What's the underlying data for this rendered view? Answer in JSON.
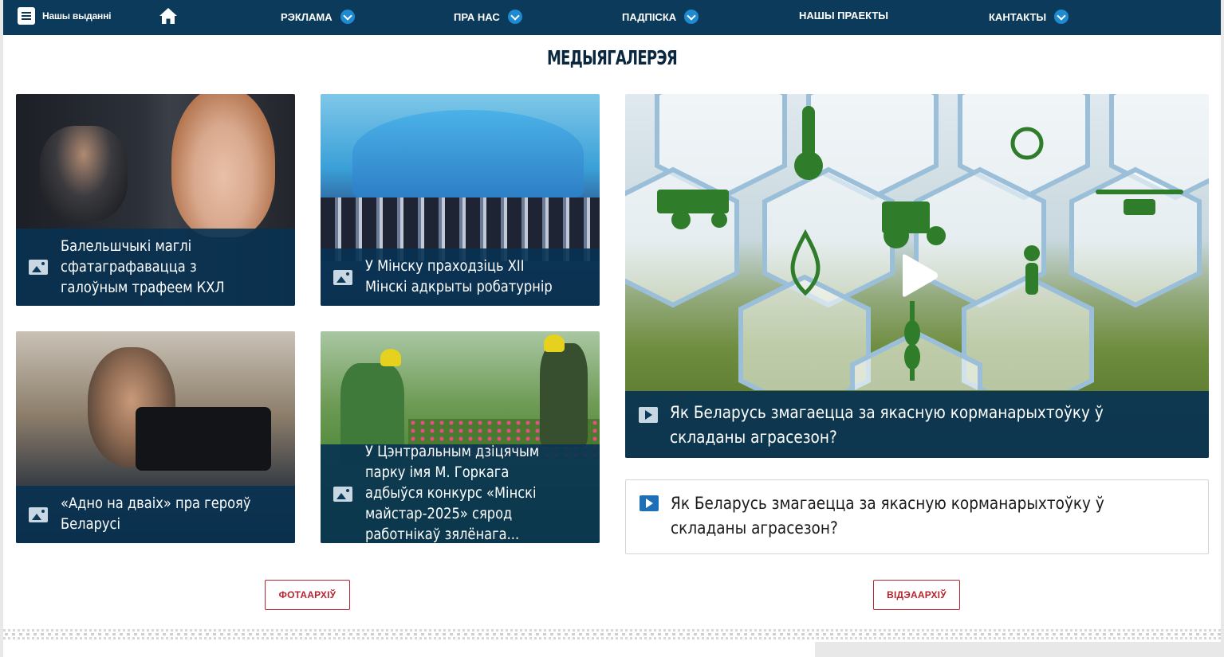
{
  "nav": {
    "menu_label": "Нашы выданні",
    "home_icon": "home-icon",
    "items": [
      {
        "label": "РЭКЛАМА",
        "has_dropdown": true
      },
      {
        "label": "ПРА НАС",
        "has_dropdown": true
      },
      {
        "label": "ПАДПІСКА",
        "has_dropdown": true
      },
      {
        "label": "НАШЫ ПРАЕКТЫ",
        "has_dropdown": false
      },
      {
        "label": "КАНТАКТЫ",
        "has_dropdown": true
      }
    ],
    "accent_color": "#1d8ad1",
    "bg_color": "#0b3a5a"
  },
  "section": {
    "title": "МЕДЫЯГАЛЕРЭЯ"
  },
  "photo_cards": [
    {
      "title": "Балельшчыкі маглі сфатаграфавацца з галоўным трафеем КХЛ",
      "icon": "image-icon"
    },
    {
      "title": "У Мінску праходзіць XII Мінскі адкрыты робатурнір",
      "icon": "image-icon"
    },
    {
      "title": "«Адно на дваіх» пра герояў Беларусі",
      "icon": "image-icon"
    },
    {
      "title": "У Цэнтральным дзіцячым парку імя М. Горкага адбыўся конкурс «Мінскі майстар-2025» сярод работнікаў зялёнага...",
      "icon": "image-icon"
    }
  ],
  "video_hero": {
    "title": "Як Беларусь змагаецца за якасную корманарыхтоўку ў складаны аграсезон?",
    "icon": "video-icon"
  },
  "video_list": [
    {
      "title": "Як Беларусь змагаецца за якасную корманарыхтоўку ў складаны аграсезон?",
      "icon": "video-icon"
    }
  ],
  "buttons": {
    "photo_archive": "ФОТААРХІЎ",
    "video_archive": "ВІДЭААРХІЎ",
    "accent_color": "#b8232f"
  }
}
